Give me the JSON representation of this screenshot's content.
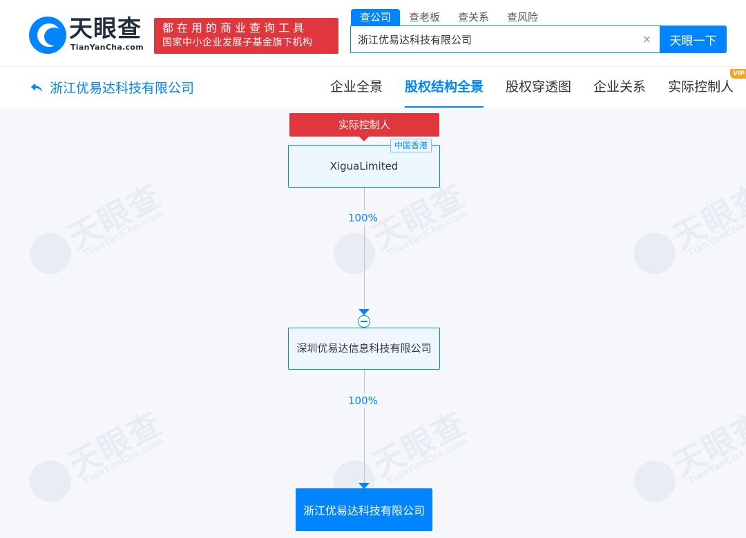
{
  "header": {
    "logo_name": "天眼查",
    "logo_sub": "TianYanCha.com",
    "slogan_line1": "都在用的商业查询工具",
    "slogan_line2": "国家中小企业发展子基金旗下机构",
    "search_tabs": [
      {
        "label": "查公司",
        "active": true
      },
      {
        "label": "查老板",
        "active": false
      },
      {
        "label": "查关系",
        "active": false
      },
      {
        "label": "查风险",
        "active": false
      }
    ],
    "search_value": "浙江优易达科技有限公司",
    "clear_icon": "×",
    "search_button": "天眼一下"
  },
  "nav": {
    "company_title": "浙江优易达科技有限公司",
    "tabs": [
      {
        "label": "企业全景",
        "active": false
      },
      {
        "label": "股权结构全景",
        "active": true
      },
      {
        "label": "股权穿透图",
        "active": false
      },
      {
        "label": "企业关系",
        "active": false
      },
      {
        "label": "实际控制人",
        "active": false
      }
    ],
    "vip_badge": "VIP"
  },
  "graph": {
    "controller_label": "实际控制人",
    "top_node": {
      "name": "XiguaLimited",
      "region_tag": "中国香港"
    },
    "edge1_pct": "100%",
    "middle_node": {
      "name": "深圳优易达信息科技有限公司"
    },
    "edge2_pct": "100%",
    "bottom_node": {
      "name": "浙江优易达科技有限公司"
    }
  },
  "watermark": {
    "text": "天眼查",
    "sub": "TianYanCha.com"
  },
  "colors": {
    "brand_blue": "#0084ff",
    "slogan_red": "#e0363e",
    "vip_orange": "#f5a623",
    "canvas_bg": "#f5f7fb"
  }
}
